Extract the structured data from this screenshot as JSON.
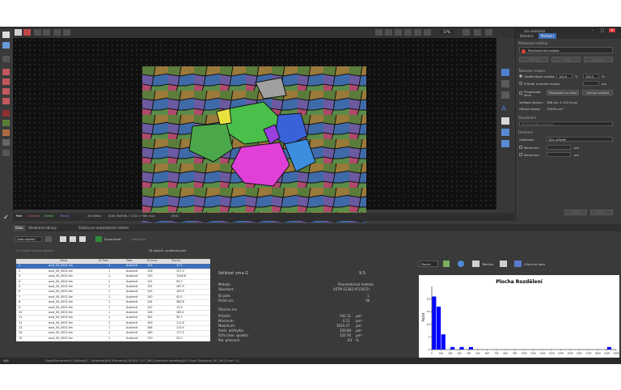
{
  "window": {
    "title": "NIS-Elements AR - Velikost zrna - [aust_50_0002.lim*]",
    "logo_text": "NIS",
    "user": "jan.vasilenko",
    "min_glyph": "–",
    "max_glyph": "□",
    "close_glyph": "✕"
  },
  "menu": [
    "Soubor",
    "Funkce",
    "Editace",
    "Aplikace",
    "Zobrazit",
    "Měření",
    "Makra",
    "Detekce",
    "Nástroje",
    "Nápověda"
  ],
  "toolbar": {
    "layout_label": "Upravit ▾"
  },
  "viewer": {
    "zoom": "37%",
    "status": {
      "mode": "Pole",
      "classes": [
        "Červená",
        "Zelená",
        "Modrá"
      ],
      "pixel_info": "2D deblur",
      "size_info": "8-Bit (8x8x8) / 1232 × 966 (a:a)",
      "scale": "[6/4]"
    }
  },
  "colors": {
    "accent": "#3d6fb8",
    "panel_bg": "#3a3a3a",
    "viewer_bg": "#101010",
    "bar": "#0000ff",
    "close_red": "#d9383a"
  },
  "right_panel": {
    "tabs": [
      "Detekce",
      "Pořízení"
    ],
    "header": "Předvolení měření",
    "method_label": "Planimetrická metoda",
    "buttons_top": [
      "Načíst",
      "Uložit",
      "Vymazat"
    ],
    "test_section": "Testovací maska",
    "rect_mask_label": "Obdélníková maska:",
    "rect_w": "100.0",
    "rect_h": "100.0",
    "unit_percent": "%",
    "unit_um": "µm",
    "circle_mask_label": "Průměr kruhové masky:",
    "circle_val": "",
    "apply_label": "Přizpůsobit oknu",
    "fit_button": "Přizpůsobit na střed",
    "size_button": "Výchozí velikost",
    "mask_size_label": "Velikost obrazu:",
    "mask_size_value": "286 µm × 222.8 µm",
    "mask_area_label": "Oblast masky:",
    "mask_area_value": "10000 µm²",
    "standard_label": "Standardní",
    "standard_value": "ASTM E1382-97(2015)",
    "restrict_section": "Omezení",
    "prop_label": "Vlastnost:",
    "prop_value": "Ekv. průměr",
    "min_label": "Minimum:",
    "max_label": "Maximum:",
    "apply_button": "Použít",
    "close_button": "Zavřít"
  },
  "bottom": {
    "tabs": [
      "Data",
      "Obsahové obrazy",
      "Složka pro automatické měření"
    ],
    "data_select": "Data objektů",
    "export_label": "Exportovat",
    "features_label": "Vlastnosti",
    "hint": "[+] rozbalí skupinu objektů",
    "summary": "36 objektů, použitelné pole",
    "table": {
      "columns": [
        "",
        "Zdroj",
        "ID Pole",
        "Fáze",
        "ID zrna",
        "Plocha"
      ],
      "rows": [
        [
          "1",
          "aust_50_0002.lim",
          "1",
          "Austenit",
          "124",
          "37.5"
        ],
        [
          "2",
          "aust_50_0002.lim",
          "1",
          "Austenit",
          "126",
          "157.0"
        ],
        [
          "3",
          "aust_50_0002.lim",
          "1",
          "Austenit",
          "130",
          "1248.8"
        ],
        [
          "4",
          "aust_50_0002.lim",
          "1",
          "Austenit",
          "131",
          "93.1"
        ],
        [
          "5",
          "aust_50_0002.lim",
          "1",
          "Austenit",
          "132",
          "167.9"
        ],
        [
          "6",
          "aust_50_0002.lim",
          "1",
          "Austenit",
          "135",
          "167.9"
        ],
        [
          "7",
          "aust_50_0002.lim",
          "1",
          "Austenit",
          "140",
          "42.0"
        ],
        [
          "8",
          "aust_50_0002.lim",
          "1",
          "Austenit",
          "144",
          "380.8"
        ],
        [
          "9",
          "aust_50_0002.lim",
          "1",
          "Austenit",
          "147",
          "13.3"
        ],
        [
          "10",
          "aust_50_0002.lim",
          "1",
          "Austenit",
          "156",
          "165.2"
        ],
        [
          "11",
          "aust_50_0002.lim",
          "1",
          "Austenit",
          "161",
          "39.7"
        ],
        [
          "12",
          "aust_50_0002.lim",
          "1",
          "Austenit",
          "163",
          "111.8"
        ],
        [
          "13",
          "aust_50_0002.lim",
          "1",
          "Austenit",
          "166",
          "115.5"
        ],
        [
          "14",
          "aust_50_0002.lim",
          "1",
          "Austenit",
          "169",
          "177.5"
        ],
        [
          "15",
          "aust_50_0002.lim",
          "1",
          "Austenit",
          "170",
          "35.2"
        ]
      ]
    },
    "stats": {
      "title": "Velikost zrna G",
      "title_value": "9.5",
      "rows": [
        {
          "label": "Metoda",
          "value": "Planimetrická metoda"
        },
        {
          "label": "Standard:",
          "value": "ASTM E1382-97(2015)"
        },
        {
          "label": "ID pole:",
          "value": "1"
        },
        {
          "label": "Počet zrn:",
          "value": "36"
        }
      ],
      "area_title": "Plocha zrn",
      "area_rows": [
        {
          "label": "Průměr:",
          "value": "192.11",
          "unit": "µm²"
        },
        {
          "label": "Minimum:",
          "value": "0.11",
          "unit": "µm²"
        },
        {
          "label": "Maximum:",
          "value": "1024.47",
          "unit": "µm²"
        },
        {
          "label": "Směr. odchylka:",
          "value": "356.88",
          "unit": "µm²"
        },
        {
          "label": "95% Inter. spolehl.:",
          "value": "120.76",
          "unit": "µm²"
        },
        {
          "label": "Rel. přesnost:",
          "value": "63",
          "unit": "%"
        }
      ]
    },
    "chart_controls": {
      "select": "Plocha",
      "table_label": "Tabulka",
      "export_label": "Všechna data"
    }
  },
  "chart_data": {
    "type": "bar",
    "title": "Plocha Rozdělení",
    "xlabel": "",
    "ylabel": "Počet",
    "categories": [
      0,
      50,
      100,
      150,
      200,
      250,
      300,
      350,
      400,
      450,
      500,
      550,
      600,
      650,
      700,
      750,
      800,
      850,
      900,
      950,
      1000,
      1050,
      1100,
      1150,
      1200,
      1250,
      1300,
      1350,
      1400,
      1450,
      1500,
      1550,
      1600,
      1650,
      1700,
      1750,
      1800,
      1850,
      1900,
      1950
    ],
    "values": [
      21,
      17,
      6,
      0,
      1,
      0,
      1,
      0,
      1,
      0,
      0,
      0,
      0,
      0,
      0,
      0,
      0,
      0,
      0,
      0,
      0,
      0,
      0,
      0,
      0,
      0,
      0,
      0,
      0,
      0,
      0,
      0,
      0,
      0,
      0,
      0,
      0,
      0,
      1,
      0
    ],
    "xticks": [
      0,
      100,
      200,
      300,
      400,
      500,
      600,
      700,
      800,
      900,
      1000,
      1100,
      1200,
      1300,
      1400,
      1500,
      1600,
      1700,
      1800,
      1900,
      2000
    ],
    "yticks": [
      0,
      5,
      10,
      15,
      20
    ],
    "xlim": [
      0,
      2000
    ],
    "ylim": [
      0,
      25
    ]
  },
  "statusbar": {
    "left": "N/A",
    "doc": "OpenDocument('C:\\Nikon\\E... Software\\NIS-Elements\\200911.117_NIS-Elements-weetting\\25 Grain Size\\aust_50_0002.lim*',2);"
  }
}
